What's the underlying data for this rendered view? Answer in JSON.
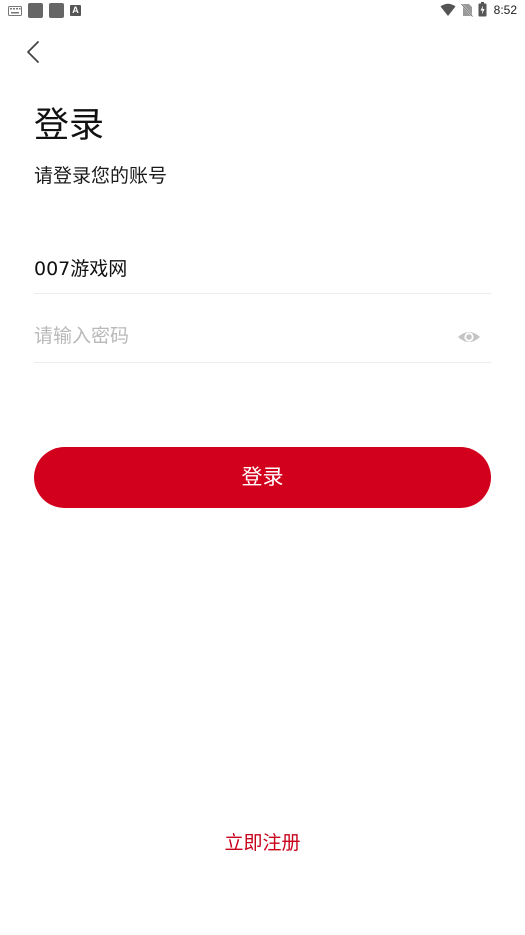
{
  "status_bar": {
    "time": "8:52",
    "left_icons": [
      "keyboard-icon",
      "app-square-icon",
      "app-square-icon",
      "font-a-icon"
    ],
    "right_icons": [
      "wifi-icon",
      "no-sim-icon",
      "battery-charging-icon"
    ],
    "a_glyph": "A"
  },
  "header": {
    "back_icon": "chevron-left-icon"
  },
  "login": {
    "title": "登录",
    "subtitle": "请登录您的账号",
    "account_value": "007游戏网",
    "password_placeholder": "请输入密码",
    "password_toggle_icon": "eye-icon",
    "submit_label": "登录",
    "register_label": "立即注册"
  },
  "colors": {
    "accent": "#d2001c",
    "register_text": "#c8001a",
    "placeholder": "#b9b9b9",
    "divider": "#ececec"
  }
}
